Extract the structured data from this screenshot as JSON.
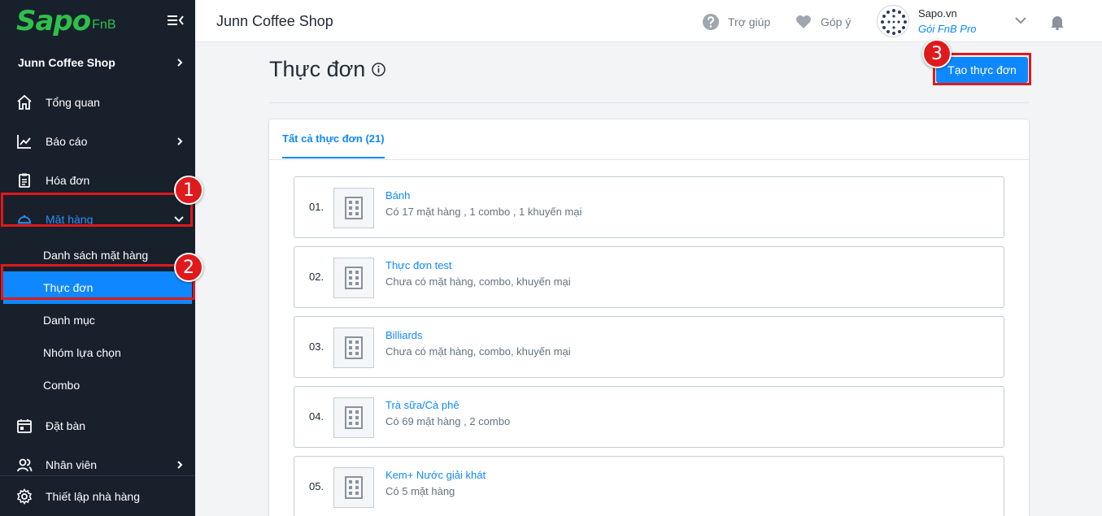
{
  "sidebar": {
    "logo_text": "Sapo",
    "logo_suffix": "FnB",
    "shop_name": "Junn Coffee Shop",
    "items": [
      {
        "label": "Tổng quan"
      },
      {
        "label": "Báo cáo"
      },
      {
        "label": "Hóa đơn"
      },
      {
        "label": "Mặt hàng"
      },
      {
        "label": "Đặt bàn"
      },
      {
        "label": "Nhân viên"
      }
    ],
    "sub_items": [
      {
        "label": "Danh sách mặt hàng"
      },
      {
        "label": "Thực đơn"
      },
      {
        "label": "Danh mục"
      },
      {
        "label": "Nhóm lựa chọn"
      },
      {
        "label": "Combo"
      }
    ],
    "bottom_label": "Thiết lập nhà hàng"
  },
  "header": {
    "title": "Junn Coffee Shop",
    "help_label": "Trợ giúp",
    "feedback_label": "Góp ý",
    "account_name": "Sapo.vn",
    "account_plan": "Gói FnB Pro"
  },
  "main": {
    "page_title": "Thực đơn",
    "create_button": "Tạo thực đơn",
    "tab_all": "Tất cả thực đơn (21)",
    "menus": [
      {
        "num": "01.",
        "name": "Bánh",
        "desc": "Có 17 mặt hàng , 1 combo , 1 khuyến mại"
      },
      {
        "num": "02.",
        "name": "Thực đơn test",
        "desc": "Chưa có mặt hàng, combo, khuyến mại"
      },
      {
        "num": "03.",
        "name": "Billiards",
        "desc": "Chưa có mặt hàng, combo, khuyến mại"
      },
      {
        "num": "04.",
        "name": "Trà sữa/Cà phê",
        "desc": "Có 69 mặt hàng , 2 combo"
      },
      {
        "num": "05.",
        "name": "Kem+ Nước giải khát",
        "desc": "Có 5 mặt hàng"
      }
    ]
  },
  "annotations": {
    "step1": "1",
    "step2": "2",
    "step3": "3"
  },
  "colors": {
    "sidebar_bg": "#18202c",
    "accent": "#0f88ff",
    "brand_green": "#2fc04a",
    "highlight_red": "#e0191c"
  }
}
